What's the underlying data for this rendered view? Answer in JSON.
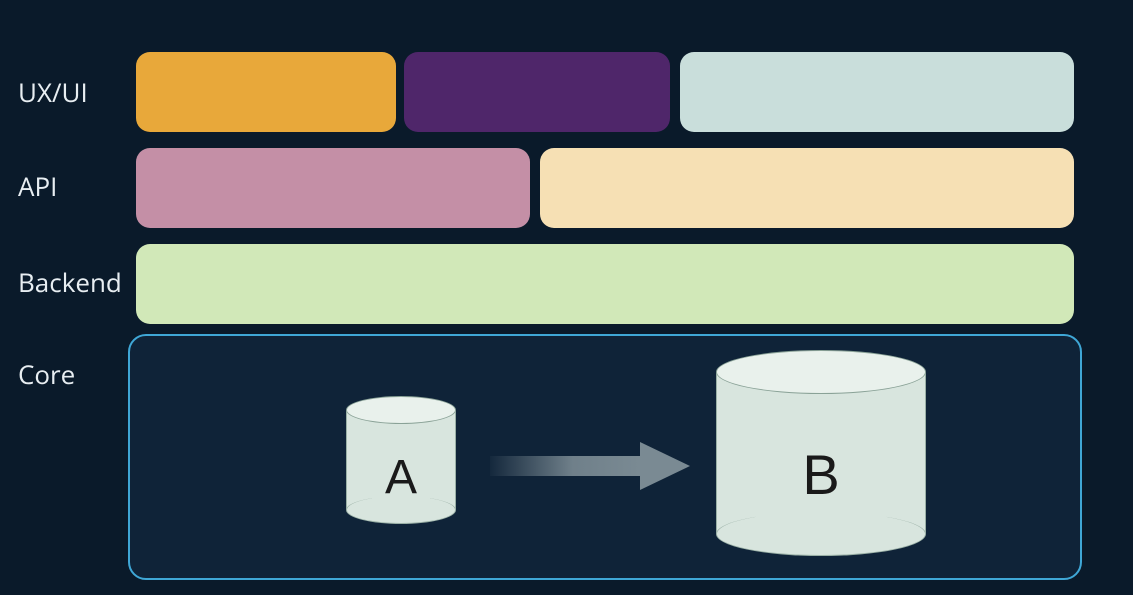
{
  "rows": {
    "r1": {
      "label": "UX/UI"
    },
    "r2": {
      "label": "API"
    },
    "r3": {
      "label": "Backend"
    },
    "r4": {
      "label": "Core"
    }
  },
  "core": {
    "db_a_label": "A",
    "db_b_label": "B"
  },
  "colors": {
    "bg": "#0a1a2a",
    "orange": "#e8a83a",
    "purple": "#4f266a",
    "teal": "#c9dedb",
    "mauve": "#c48fa6",
    "cream": "#f6e0b4",
    "sage": "#d1e8b8",
    "core_border": "#3fa7d6",
    "core_fill": "#0f2338",
    "cyl_fill": "#d8e5de",
    "arrow": "#7a8a93"
  }
}
